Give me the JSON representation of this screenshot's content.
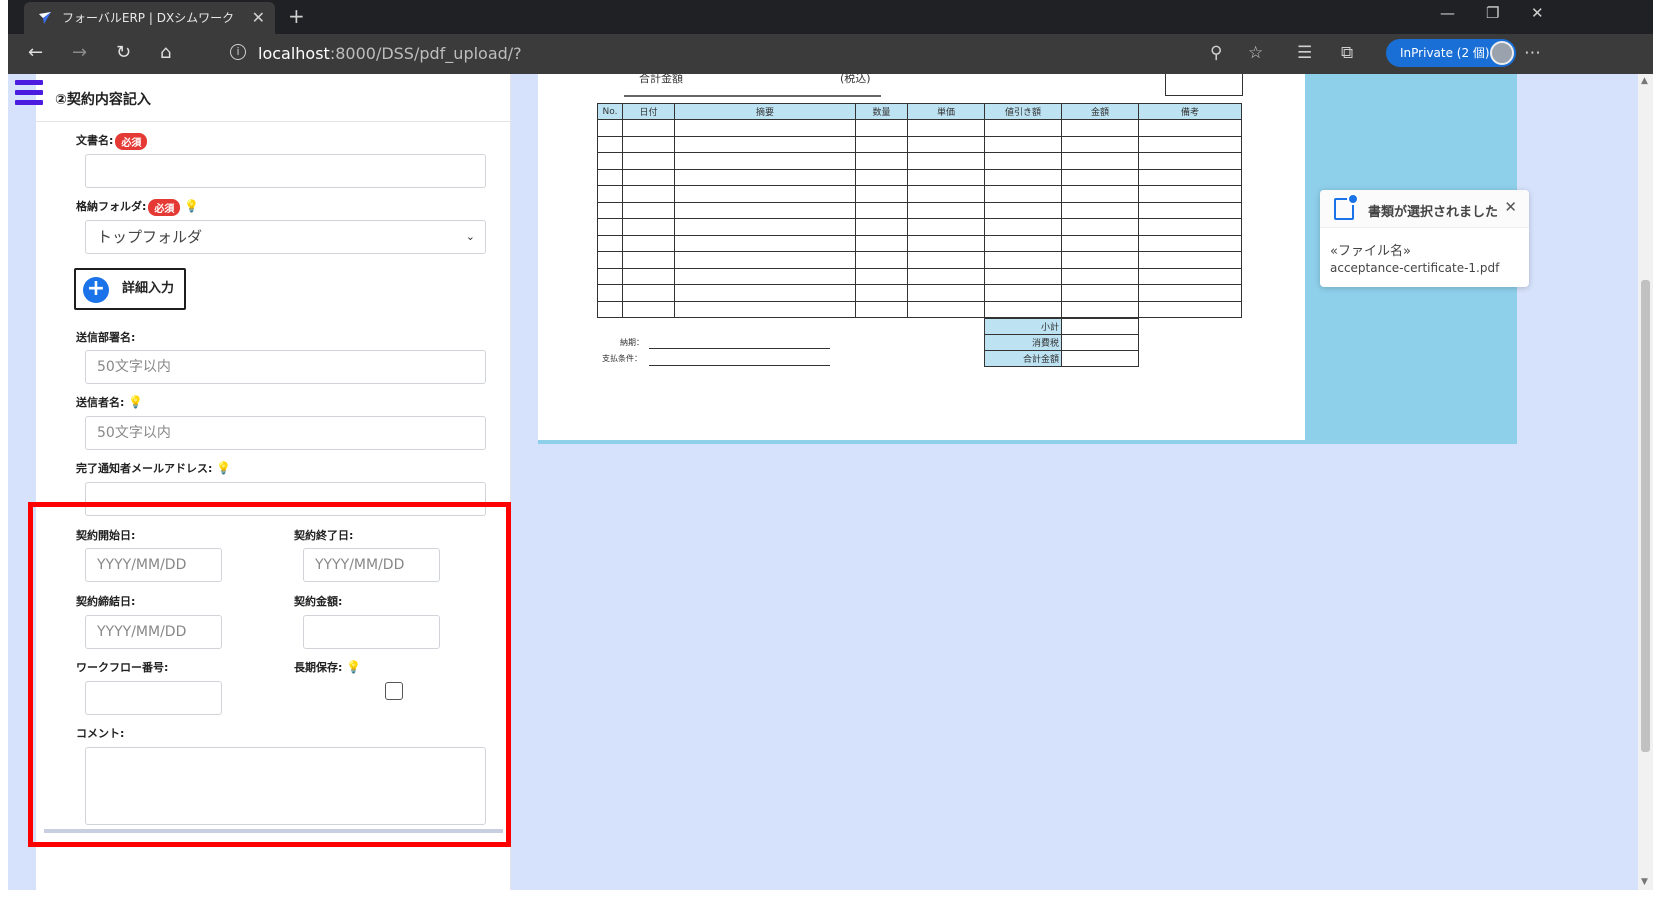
{
  "browser": {
    "tab_title": "フォーバルERP | DXシムワーク",
    "url_host": "localhost",
    "url_rest": ":8000/DSS/pdf_upload/?",
    "inprivate_label": "InPrivate (2 個)"
  },
  "panel": {
    "title": "②契約内容記入",
    "required_badge": "必須",
    "doc_name_label": "文書名:",
    "folder_label": "格納フォルダ:",
    "folder_value": "トップフォルダ",
    "detail_button": "詳細入力",
    "sender_dept_label": "送信部署名:",
    "sender_dept_placeholder": "50文字以内",
    "sender_name_label": "送信者名:",
    "sender_name_placeholder": "50文字以内",
    "notify_email_label": "完了通知者メールアドレス:",
    "start_date_label": "契約開始日:",
    "start_date_placeholder": "YYYY/MM/DD",
    "end_date_label": "契約終了日:",
    "end_date_placeholder": "YYYY/MM/DD",
    "signed_date_label": "契約締結日:",
    "signed_date_placeholder": "YYYY/MM/DD",
    "amount_label": "契約金額:",
    "workflow_label": "ワークフロー番号:",
    "long_term_label": "長期保存:",
    "comment_label": "コメント:"
  },
  "pdf": {
    "total_label": "合計金額",
    "tax_label": "(税込)",
    "columns": [
      "No.",
      "日付",
      "摘要",
      "数量",
      "単価",
      "値引き額",
      "金額",
      "備考"
    ],
    "row_count": 12,
    "delivery_label": "納期：",
    "payment_label": "支払条件：",
    "totals": [
      "小計",
      "消費税",
      "合計金額"
    ]
  },
  "toast": {
    "title": "書類が選択されました",
    "line1": "«ファイル名»",
    "line2": "acceptance-certificate-1.pdf"
  },
  "colors": {
    "accent": "#1a73e8",
    "highlight": "#ff0000",
    "page_bg": "#d6e2fb",
    "required": "#e53935"
  }
}
